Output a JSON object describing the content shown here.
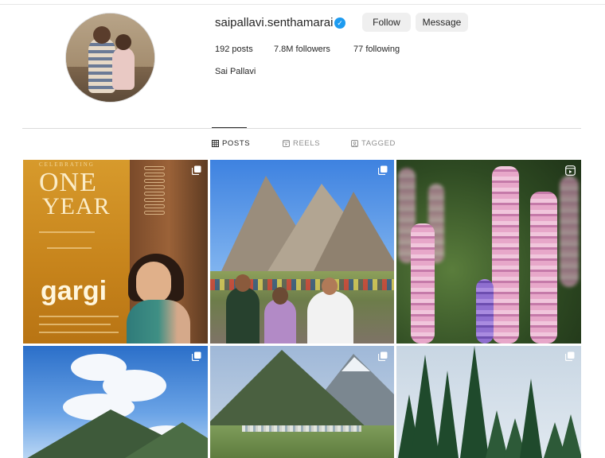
{
  "profile": {
    "username": "saipallavi.senthamarai",
    "verified_glyph": "✓",
    "follow_label": "Follow",
    "message_label": "Message",
    "posts_count": "192",
    "posts_label": "posts",
    "followers_count": "7.8M",
    "followers_label": "followers",
    "following_count": "77",
    "following_label": "following",
    "full_name": "Sai Pallavi"
  },
  "tabs": [
    {
      "label": "POSTS",
      "icon": "grid-icon",
      "active": true
    },
    {
      "label": "REELS",
      "icon": "reels-icon",
      "active": false
    },
    {
      "label": "TAGGED",
      "icon": "tagged-icon",
      "active": false
    }
  ],
  "grid": {
    "tile1": {
      "poster_celebrating": "CELEBRATING",
      "poster_one": "ONE",
      "poster_year": "YEAR",
      "poster_title": "gargi",
      "badge": "multi-post-icon"
    },
    "tile2": {
      "badge": "multi-post-icon"
    },
    "tile3": {
      "badge": "reel-icon"
    },
    "tile4": {
      "badge": "multi-post-icon"
    },
    "tile5": {
      "badge": "multi-post-icon"
    },
    "tile6": {
      "badge": "multi-post-icon"
    }
  },
  "colors": {
    "verified": "#1d9bf0",
    "button_bg": "#efefef",
    "text_primary": "#262626",
    "text_muted": "#8e8e8e"
  }
}
